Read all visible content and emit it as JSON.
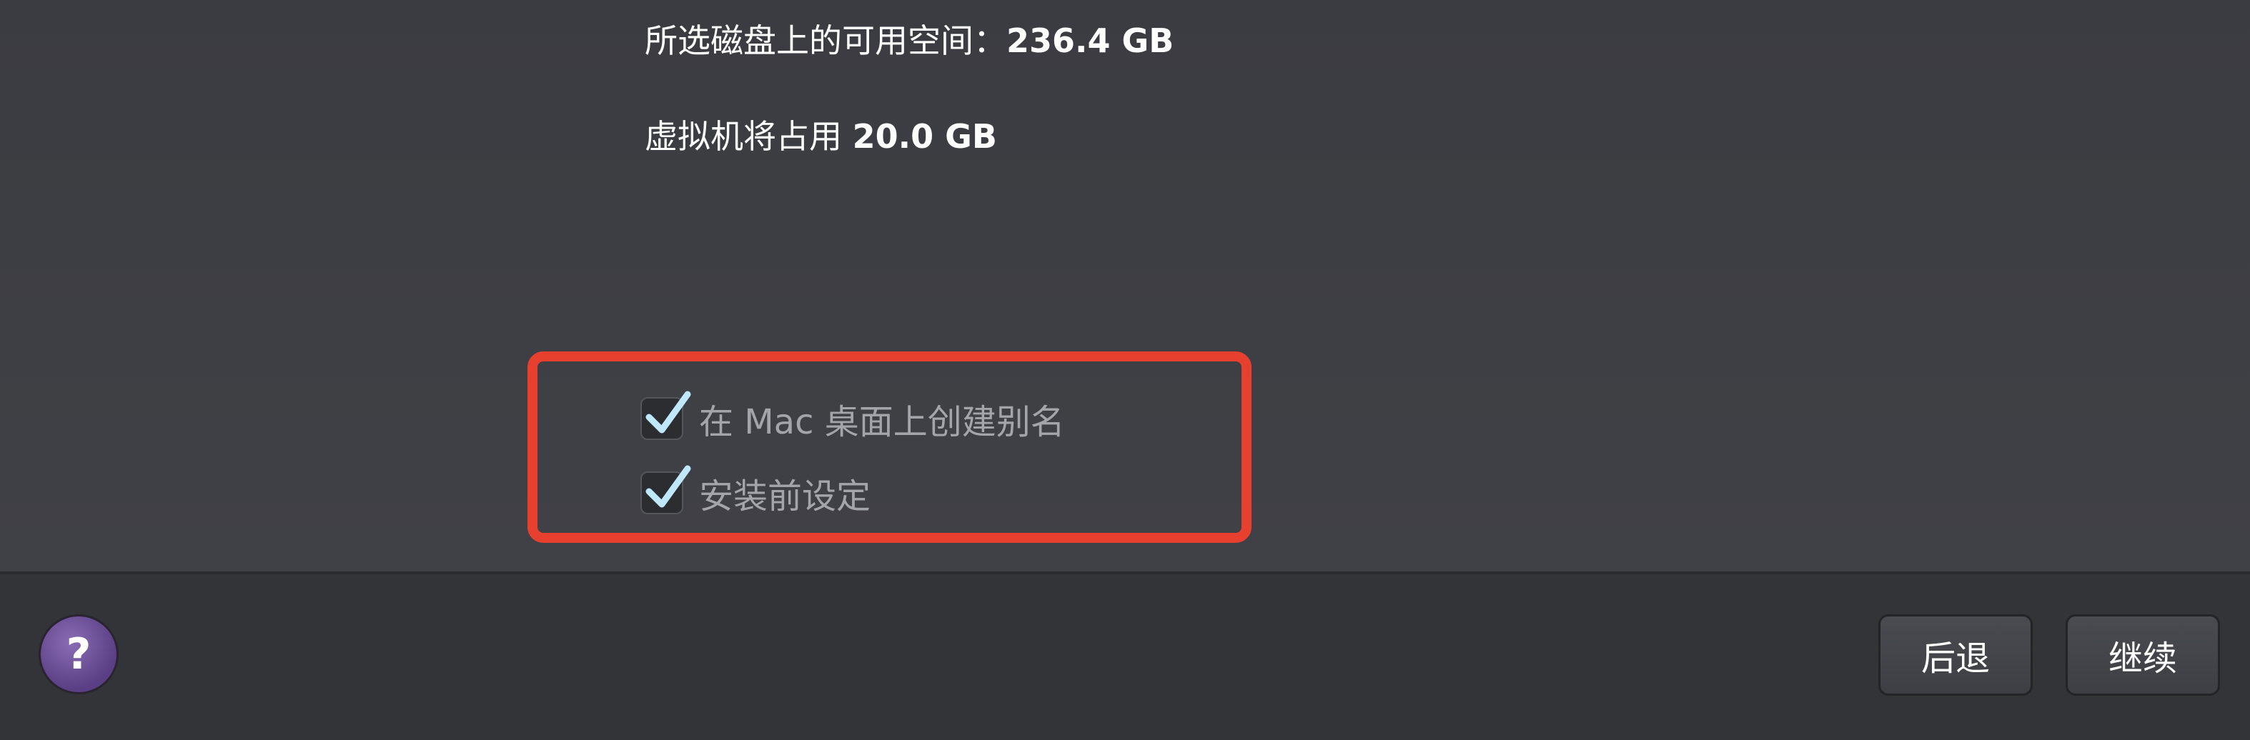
{
  "disk_info": {
    "free_space_label": "所选磁盘上的可用空间：",
    "free_space_value": "236.4 GB",
    "vm_usage_label": "虚拟机将占用 ",
    "vm_usage_value": "20.0 GB"
  },
  "options": {
    "create_alias": {
      "label": "在 Mac 桌面上创建别名",
      "checked": true
    },
    "configure_before_install": {
      "label": "安装前设定",
      "checked": true
    }
  },
  "footer": {
    "help_label": "?",
    "back_label": "后退",
    "continue_label": "继续"
  },
  "colors": {
    "highlight": "#e8402f",
    "checkmark": "#bfe8ff",
    "help_button": "#6b4c96"
  }
}
